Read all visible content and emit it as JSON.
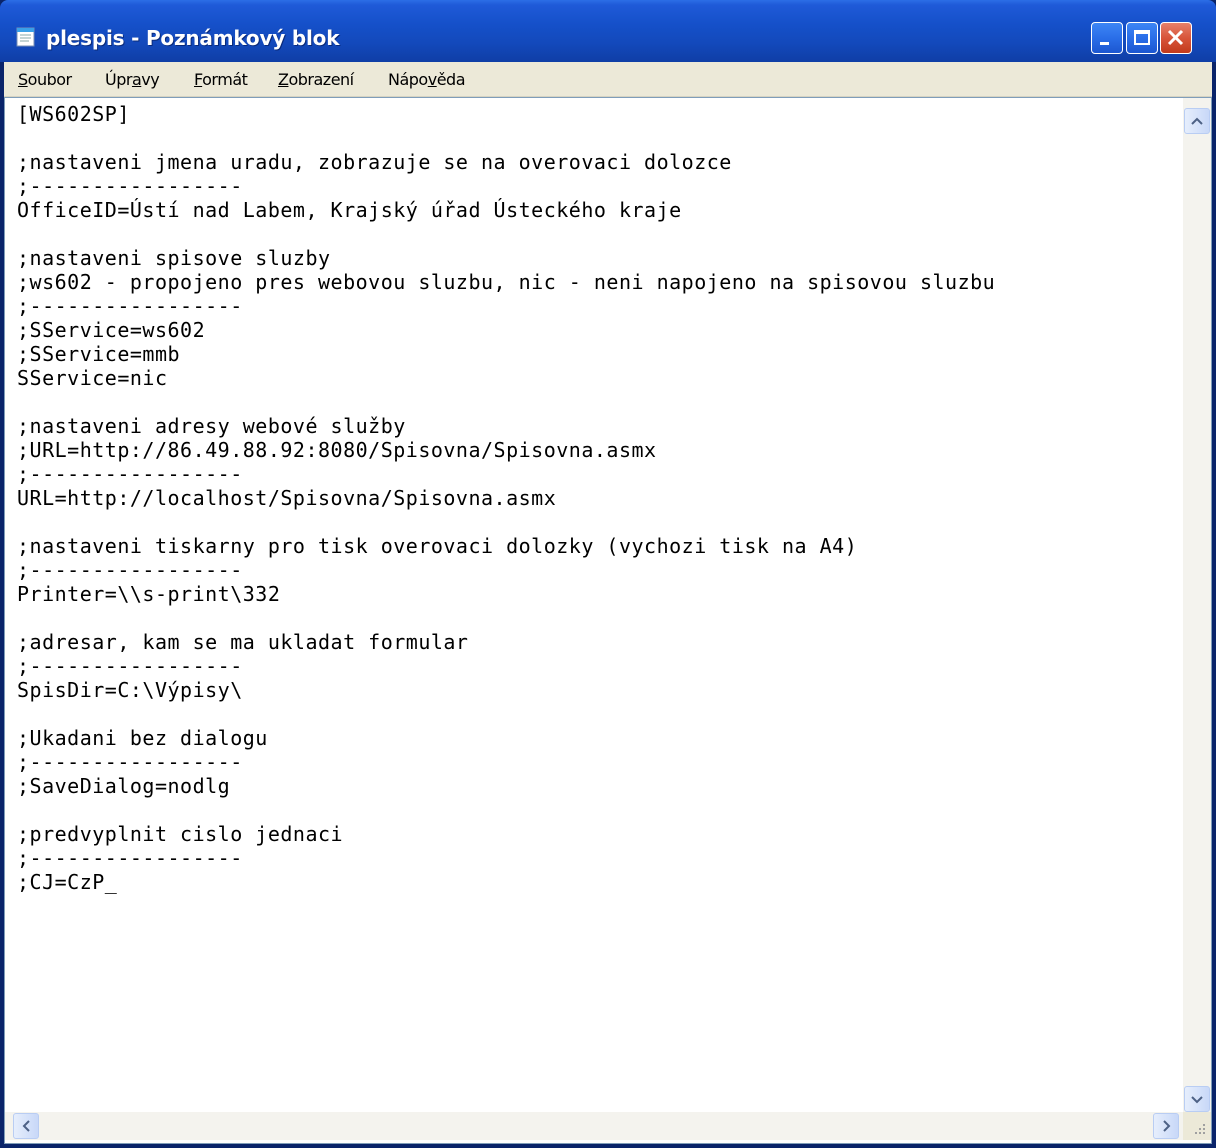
{
  "window": {
    "title": "plespis - Poznámkový blok"
  },
  "menu": [
    {
      "prefix": "",
      "key": "S",
      "rest": "oubor"
    },
    {
      "prefix": "Úpr",
      "key": "a",
      "rest": "vy"
    },
    {
      "prefix": "",
      "key": "F",
      "rest": "ormát"
    },
    {
      "prefix": "",
      "key": "Z",
      "rest": "obrazení"
    },
    {
      "prefix": "Nápo",
      "key": "v",
      "rest": "ěda"
    }
  ],
  "document": {
    "lines": [
      "[WS602SP]",
      "",
      ";nastaveni jmena uradu, zobrazuje se na overovaci dolozce",
      ";-----------------",
      "OfficeID=Ústí nad Labem, Krajský úřad Ústeckého kraje",
      "",
      ";nastaveni spisove sluzby",
      ";ws602 - propojeno pres webovou sluzbu, nic - neni napojeno na spisovou sluzbu",
      ";-----------------",
      ";SService=ws602",
      ";SService=mmb",
      "SService=nic",
      "",
      ";nastaveni adresy webové služby",
      ";URL=http://86.49.88.92:8080/Spisovna/Spisovna.asmx",
      ";-----------------",
      "URL=http://localhost/Spisovna/Spisovna.asmx",
      "",
      ";nastaveni tiskarny pro tisk overovaci dolozky (vychozi tisk na A4)",
      ";-----------------",
      "Printer=\\\\s-print\\332",
      "",
      ";adresar, kam se ma ukladat formular",
      ";-----------------",
      "SpisDir=C:\\Výpisy\\",
      "",
      ";Ukadani bez dialogu",
      ";-----------------",
      ";SaveDialog=nodlg",
      "",
      ";predvyplnit cislo jednaci",
      ";-----------------",
      ";CJ=CzP_"
    ]
  },
  "icons": {
    "app": "notepad-icon",
    "minimize": "minimize-icon",
    "maximize": "maximize-icon",
    "close": "close-icon"
  }
}
